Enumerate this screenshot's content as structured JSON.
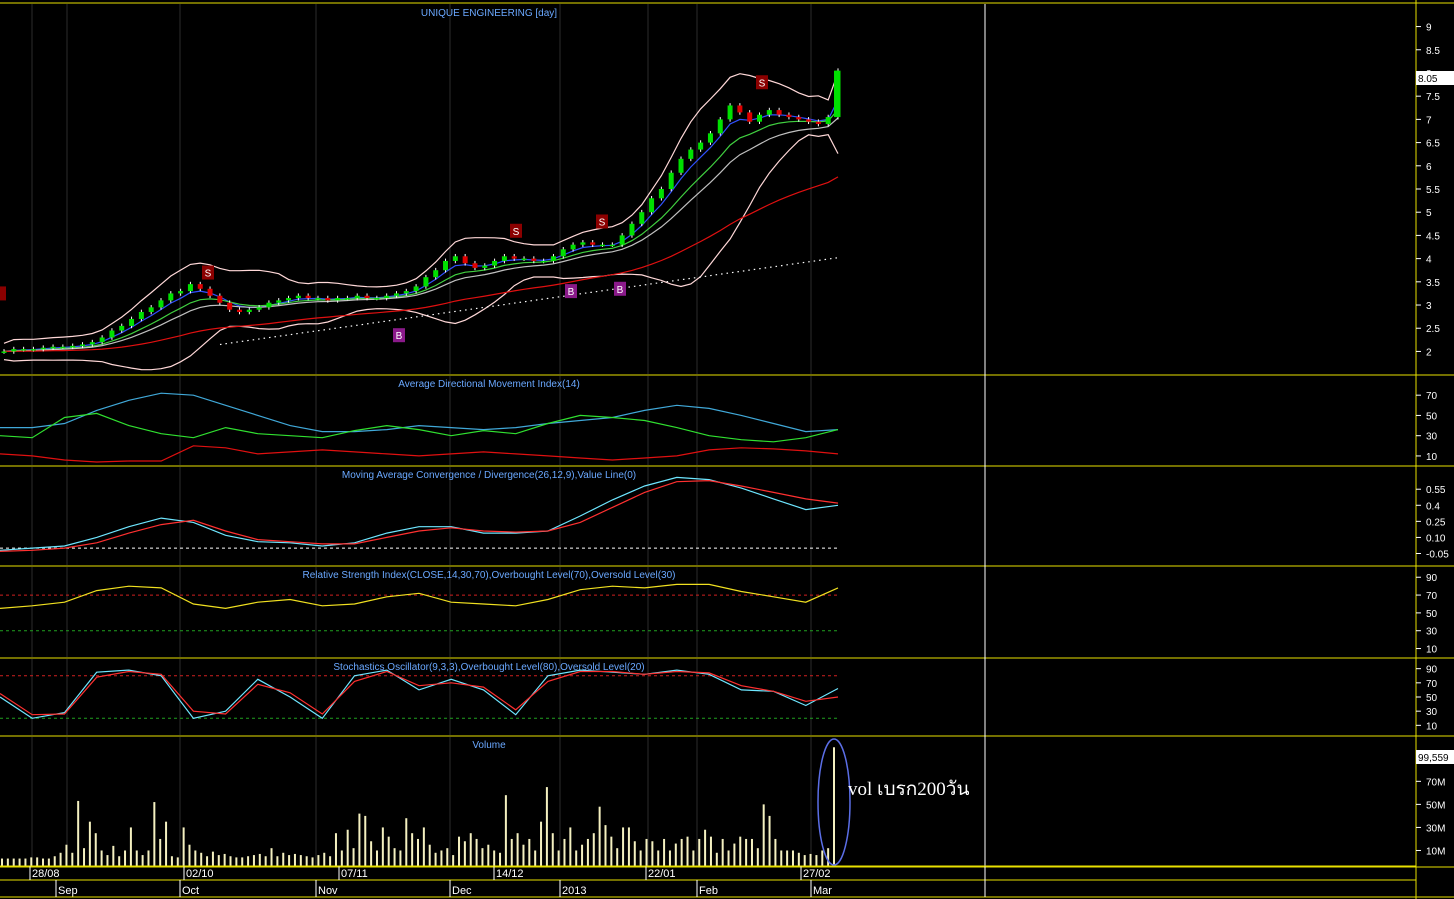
{
  "window": {
    "title": "UNIQUE ENGINEERING [day]",
    "last_price_label": "8.05",
    "last_volume_label": "99,559"
  },
  "annotation": {
    "text": "vol เบรก200วัน",
    "color": "#ffffff",
    "ellipse_color": "#5b6ee6"
  },
  "colors": {
    "background": "#000000",
    "panel_border": "#e8e000",
    "grid": "#2b2b2b",
    "cursor_line": "#ffffff",
    "up_candle": "#00e000",
    "down_candle": "#e00000",
    "bollinger": "#ffd8d8",
    "ema_fast": "#3050ff",
    "ema_mid": "#40d040",
    "ema_slow": "#c0c0c0",
    "ma_200": "#e01010",
    "trend_dots": "#ffffff",
    "signal_sell": "#8b0000",
    "signal_buy": "#8a1a8a",
    "title_text": "#6aa8ff",
    "axis_text": "#ffffff"
  },
  "time_axis": {
    "dates": [
      "28/08",
      "02/10",
      "07/11",
      "14/12",
      "22/01",
      "27/02"
    ],
    "months": [
      "Sep",
      "Oct",
      "Nov",
      "Dec",
      "2013",
      "Feb",
      "Mar"
    ]
  },
  "chart_data": [
    {
      "type": "candlestick",
      "title": "UNIQUE ENGINEERING [day]",
      "ylim": [
        1.6,
        9.4
      ],
      "y_ticks": [
        "9",
        "8.5",
        "8",
        "7.5",
        "7",
        "6.5",
        "6",
        "5.5",
        "5",
        "4.5",
        "4",
        "3.5",
        "3",
        "2.5",
        "2"
      ],
      "close_series": [
        2.0,
        2.05,
        2.05,
        2.05,
        2.08,
        2.1,
        2.1,
        2.12,
        2.15,
        2.2,
        2.3,
        2.45,
        2.55,
        2.7,
        2.85,
        2.95,
        3.1,
        3.25,
        3.3,
        3.45,
        3.35,
        3.2,
        3.05,
        2.9,
        2.85,
        2.9,
        2.95,
        3.05,
        3.1,
        3.15,
        3.2,
        3.15,
        3.15,
        3.1,
        3.15,
        3.15,
        3.2,
        3.15,
        3.15,
        3.2,
        3.25,
        3.3,
        3.4,
        3.6,
        3.75,
        3.95,
        4.05,
        3.9,
        3.8,
        3.85,
        3.95,
        4.05,
        4.0,
        4.0,
        3.95,
        3.95,
        4.05,
        4.2,
        4.3,
        4.35,
        4.3,
        4.3,
        4.3,
        4.5,
        4.75,
        5.0,
        5.3,
        5.5,
        5.85,
        6.15,
        6.35,
        6.5,
        6.7,
        7.0,
        7.3,
        7.15,
        6.95,
        7.1,
        7.2,
        7.1,
        7.05,
        7.0,
        6.95,
        6.9,
        7.05,
        8.05
      ],
      "signals": [
        {
          "label": "S",
          "type": "sell",
          "price": 3.7
        },
        {
          "label": "S",
          "type": "sell",
          "price": 4.6
        },
        {
          "label": "S",
          "type": "sell",
          "price": 4.8
        },
        {
          "label": "S",
          "type": "sell",
          "price": 7.8
        },
        {
          "label": "B",
          "type": "buy",
          "price": 2.35
        },
        {
          "label": "B",
          "type": "buy",
          "price": 3.3
        },
        {
          "label": "B",
          "type": "buy",
          "price": 3.35
        }
      ],
      "last_price": 8.05
    },
    {
      "type": "line",
      "title": "Average Directional Movement Index(14)",
      "ylim": [
        5,
        85
      ],
      "y_ticks": [
        "70",
        "50",
        "30",
        "10"
      ],
      "series": [
        {
          "color": "#40a8d8",
          "values": [
            38,
            38,
            42,
            55,
            65,
            72,
            70,
            60,
            50,
            40,
            34,
            34,
            36,
            40,
            38,
            36,
            38,
            42,
            45,
            48,
            55,
            60,
            57,
            50,
            42,
            34,
            36
          ]
        },
        {
          "color": "#30e030",
          "values": [
            30,
            28,
            48,
            52,
            40,
            32,
            28,
            38,
            32,
            30,
            28,
            35,
            40,
            36,
            30,
            35,
            32,
            42,
            50,
            48,
            45,
            38,
            30,
            26,
            24,
            28,
            36
          ]
        },
        {
          "color": "#e01010",
          "values": [
            12,
            10,
            6,
            4,
            5,
            5,
            20,
            18,
            12,
            14,
            16,
            14,
            12,
            10,
            12,
            14,
            12,
            10,
            8,
            6,
            8,
            10,
            16,
            18,
            17,
            15,
            12
          ]
        }
      ]
    },
    {
      "type": "line",
      "title": "Moving Average Convergence / Divergence(26,12,9),Value Line(0)",
      "ylim": [
        -0.12,
        0.72
      ],
      "y_ticks": [
        "0.55",
        "0.4",
        "0.25",
        "0.10",
        "-0.05"
      ],
      "series": [
        {
          "color": "#6ee6ff",
          "values": [
            -0.02,
            0.0,
            0.02,
            0.1,
            0.2,
            0.28,
            0.24,
            0.12,
            0.06,
            0.05,
            0.02,
            0.05,
            0.14,
            0.2,
            0.2,
            0.14,
            0.14,
            0.16,
            0.3,
            0.45,
            0.58,
            0.66,
            0.64,
            0.56,
            0.46,
            0.36,
            0.4
          ]
        },
        {
          "color": "#ff3030",
          "values": [
            -0.03,
            -0.02,
            0.0,
            0.05,
            0.14,
            0.22,
            0.26,
            0.16,
            0.08,
            0.06,
            0.04,
            0.04,
            0.1,
            0.16,
            0.19,
            0.16,
            0.15,
            0.16,
            0.24,
            0.38,
            0.52,
            0.62,
            0.63,
            0.58,
            0.52,
            0.46,
            0.42
          ]
        }
      ],
      "value_line": 0
    },
    {
      "type": "line",
      "title": "Relative Strength Index(CLOSE,14,30,70),Overbought Level(70),Oversold Level(30)",
      "ylim": [
        5,
        97
      ],
      "y_ticks": [
        "90",
        "70",
        "50",
        "30",
        "10"
      ],
      "overbought": 70,
      "oversold": 30,
      "series": [
        {
          "color": "#f0e020",
          "values": [
            55,
            58,
            62,
            75,
            80,
            78,
            60,
            55,
            62,
            65,
            58,
            60,
            68,
            72,
            62,
            60,
            58,
            65,
            76,
            80,
            78,
            82,
            82,
            74,
            68,
            62,
            78
          ]
        }
      ]
    },
    {
      "type": "line",
      "title": "Stochastics Oscillator(9,3,3),Overbought Level(80),Oversold Level(20)",
      "ylim": [
        2,
        98
      ],
      "y_ticks": [
        "90",
        "70",
        "50",
        "30",
        "10"
      ],
      "overbought": 80,
      "oversold": 20,
      "series": [
        {
          "color": "#6ee6ff",
          "values": [
            50,
            20,
            28,
            85,
            88,
            80,
            20,
            30,
            75,
            50,
            20,
            80,
            88,
            60,
            75,
            60,
            25,
            80,
            88,
            85,
            82,
            88,
            82,
            60,
            58,
            38,
            62
          ]
        },
        {
          "color": "#ff3030",
          "values": [
            55,
            25,
            26,
            78,
            86,
            82,
            30,
            26,
            68,
            56,
            26,
            72,
            86,
            66,
            70,
            64,
            32,
            72,
            86,
            86,
            82,
            86,
            84,
            66,
            58,
            44,
            50
          ]
        }
      ]
    },
    {
      "type": "bar",
      "title": "Volume",
      "ylim": [
        0,
        105
      ],
      "y_ticks": [
        "70M",
        "50M",
        "30M",
        "10M"
      ],
      "unit": "M",
      "values": [
        3,
        3,
        3,
        3,
        3,
        4,
        4,
        3,
        3,
        5,
        8,
        15,
        8,
        53,
        12,
        35,
        25,
        10,
        6,
        14,
        5,
        10,
        30,
        10,
        6,
        10,
        52,
        20,
        35,
        5,
        4,
        30,
        15,
        10,
        8,
        5,
        9,
        6,
        7,
        5,
        4,
        4,
        5,
        6,
        7,
        5,
        12,
        5,
        8,
        6,
        7,
        6,
        5,
        4,
        6,
        8,
        5,
        25,
        10,
        28,
        12,
        42,
        40,
        18,
        10,
        30,
        22,
        12,
        10,
        38,
        25,
        20,
        30,
        15,
        8,
        10,
        12,
        6,
        22,
        18,
        25,
        20,
        12,
        15,
        10,
        8,
        58,
        20,
        25,
        15,
        20,
        10,
        35,
        65,
        25,
        10,
        20,
        30,
        10,
        15,
        20,
        25,
        48,
        32,
        22,
        12,
        30,
        30,
        18,
        10,
        20,
        18,
        10,
        20,
        10,
        16,
        20,
        22,
        10,
        20,
        28,
        22,
        8,
        20,
        10,
        16,
        22,
        20,
        20,
        12,
        50,
        40,
        20,
        10,
        10,
        10,
        8,
        6,
        7,
        6,
        10,
        12,
        99.559
      ]
    }
  ]
}
